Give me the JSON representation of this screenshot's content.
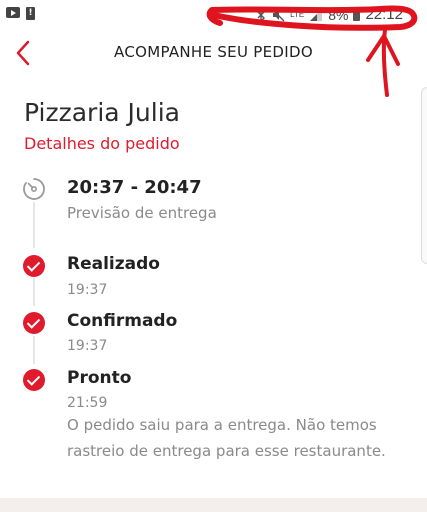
{
  "status_bar": {
    "left_icons": [
      "youtube-icon",
      "alert-icon"
    ],
    "network": "LTE",
    "battery": "8%",
    "time": "22:12"
  },
  "header": {
    "title": "ACOMPANHE SEU PEDIDO",
    "back_icon": "chevron-left-icon"
  },
  "order": {
    "store_name": "Pizzaria Julia",
    "details_link": "Detalhes do pedido"
  },
  "timeline": {
    "eta": {
      "time": "20:37 - 20:47",
      "label": "Previsão de entrega"
    },
    "steps": [
      {
        "title": "Realizado",
        "time": "19:37"
      },
      {
        "title": "Confirmado",
        "time": "19:37"
      },
      {
        "title": "Pronto",
        "time": "21:59",
        "message": "O pedido saiu para a entrega. Não temos rastreio de entrega para esse restaurante."
      }
    ]
  },
  "colors": {
    "accent": "#e01b2d",
    "annotation": "#e0141e",
    "muted_text": "#8a8a8a"
  }
}
